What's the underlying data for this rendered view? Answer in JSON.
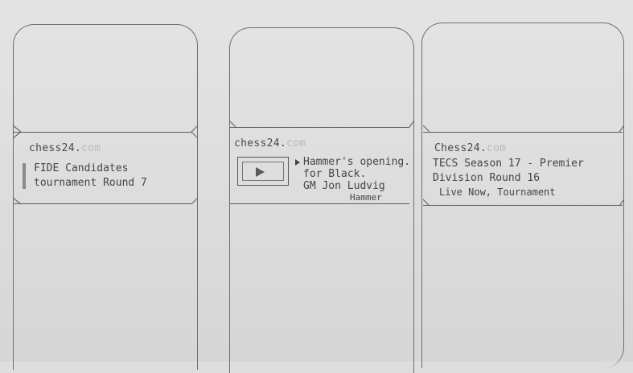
{
  "cards": [
    {
      "brand": "chess24.",
      "brand_faded": "com",
      "headline_line1": "FIDE Candidates",
      "headline_line2": "tournament Round 7"
    },
    {
      "brand": "chess24.",
      "brand_faded": "com",
      "headline_line1": "Hammer's opening.",
      "headline_line2": "for Black.",
      "headline_line3": "GM Jon Ludvig",
      "headline_line4": "Hammer",
      "thumbnail_icon": "play-icon"
    },
    {
      "brand": "Chess24.",
      "brand_faded": "com",
      "headline_line1": "TECS Season 17 - Premier",
      "headline_line2": "Division Round 16",
      "headline_line3": "Live Now, Tournament"
    }
  ]
}
